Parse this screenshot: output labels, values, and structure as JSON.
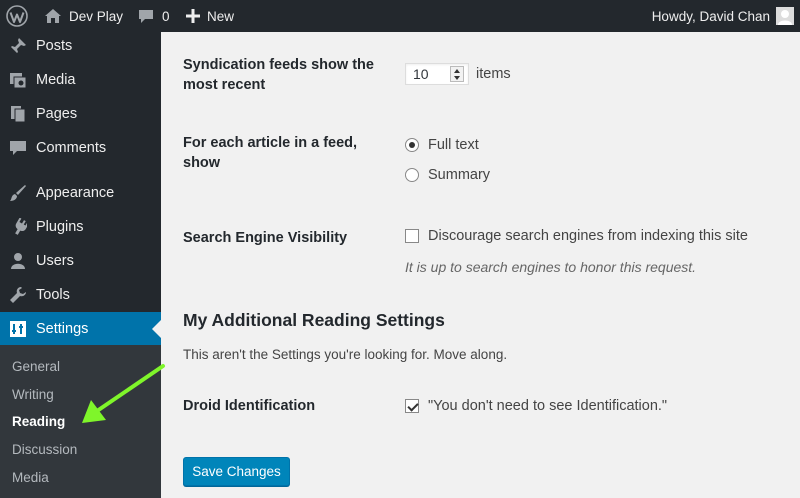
{
  "adminbar": {
    "site_name": "Dev Play",
    "comment_count": "0",
    "new_label": "New",
    "howdy": "Howdy, David Chan"
  },
  "sidebar": {
    "items": [
      {
        "label": "Posts",
        "icon": "pushpin-icon"
      },
      {
        "label": "Media",
        "icon": "media-icon"
      },
      {
        "label": "Pages",
        "icon": "pages-icon"
      },
      {
        "label": "Comments",
        "icon": "comment-icon"
      },
      {
        "label": "Appearance",
        "icon": "paintbrush-icon"
      },
      {
        "label": "Plugins",
        "icon": "plugin-icon"
      },
      {
        "label": "Users",
        "icon": "user-icon"
      },
      {
        "label": "Tools",
        "icon": "wrench-icon"
      },
      {
        "label": "Settings",
        "icon": "settings-icon",
        "current": true
      }
    ],
    "submenu": [
      "General",
      "Writing",
      "Reading",
      "Discussion",
      "Media"
    ],
    "current_sub": "Reading"
  },
  "content": {
    "feeds_label": [
      "Syndication feeds show the",
      "most recent"
    ],
    "feeds_value": "10",
    "feeds_unit": "items",
    "article_label": [
      "For each article in a feed,",
      "show"
    ],
    "article_options": [
      "Full text",
      "Summary"
    ],
    "article_selected": "Full text",
    "visibility_label": "Search Engine Visibility",
    "visibility_option": "Discourage search engines from indexing this site",
    "visibility_hint": "It is up to search engines to honor this request.",
    "section_title": "My Additional Reading Settings",
    "section_desc": "This aren't the Settings you're looking for. Move along.",
    "droid_label": "Droid Identification",
    "droid_option": "\"You don't need to see Identification.\"",
    "save_label": "Save Changes"
  },
  "colors": {
    "accent": "#0073aa",
    "button": "#0085ba",
    "annotation_arrow": "#7ff52a"
  }
}
